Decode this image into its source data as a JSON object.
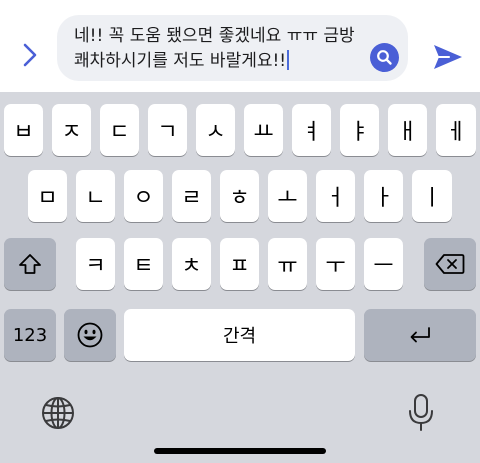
{
  "compose": {
    "message_text": "네!! 꼭 도움 됐으면 좋겠네요 ㅠㅠ 금방 쾌차하시기를 저도 바랄게요!!",
    "accent_color": "#4a5fd6"
  },
  "keyboard": {
    "row1": [
      "ㅂ",
      "ㅈ",
      "ㄷ",
      "ㄱ",
      "ㅅ",
      "ㅛ",
      "ㅕ",
      "ㅑ",
      "ㅐ",
      "ㅔ"
    ],
    "row2": [
      "ㅁ",
      "ㄴ",
      "ㅇ",
      "ㄹ",
      "ㅎ",
      "ㅗ",
      "ㅓ",
      "ㅏ",
      "ㅣ"
    ],
    "row3": [
      "ㅋ",
      "ㅌ",
      "ㅊ",
      "ㅍ",
      "ㅠ",
      "ㅜ",
      "ㅡ"
    ],
    "numbers_label": "123",
    "space_label": "간격",
    "icons": {
      "shift": "shift-icon",
      "delete": "delete-icon",
      "emoji": "emoji-icon",
      "return": "return-icon",
      "globe": "globe-icon",
      "mic": "microphone-icon"
    }
  }
}
